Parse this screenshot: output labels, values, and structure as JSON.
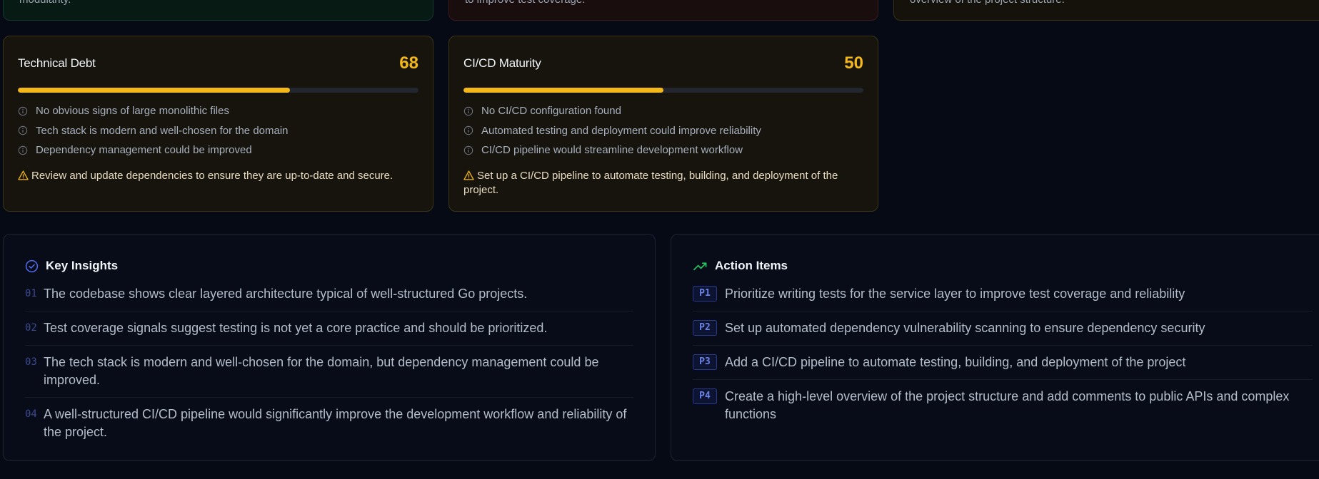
{
  "top_cards": [
    {
      "fragment": "modularity."
    },
    {
      "fragment": "to improve test coverage."
    },
    {
      "fragment": "overview of the project structure."
    }
  ],
  "technical_debt": {
    "title": "Technical Debt",
    "score": "68",
    "progress_percent": 68,
    "findings": [
      "No obvious signs of large monolithic files",
      "Tech stack is modern and well-chosen for the domain",
      "Dependency management could be improved"
    ],
    "recommendation": "Review and update dependencies to ensure they are up-to-date and secure."
  },
  "cicd_maturity": {
    "title": "CI/CD Maturity",
    "score": "50",
    "progress_percent": 50,
    "findings": [
      "No CI/CD configuration found",
      "Automated testing and deployment could improve reliability",
      "CI/CD pipeline would streamline development workflow"
    ],
    "recommendation": "Set up a CI/CD pipeline to automate testing, building, and deployment of the project."
  },
  "key_insights": {
    "title": "Key Insights",
    "items": [
      {
        "num": "01",
        "text": "The codebase shows clear layered architecture typical of well-structured Go projects."
      },
      {
        "num": "02",
        "text": "Test coverage signals suggest testing is not yet a core practice and should be prioritized."
      },
      {
        "num": "03",
        "text": "The tech stack is modern and well-chosen for the domain, but dependency management could be improved."
      },
      {
        "num": "04",
        "text": "A well-structured CI/CD pipeline would significantly improve the development workflow and reliability of the project."
      }
    ]
  },
  "action_items": {
    "title": "Action Items",
    "items": [
      {
        "priority": "P1",
        "text": "Prioritize writing tests for the service layer to improve test coverage and reliability"
      },
      {
        "priority": "P2",
        "text": "Set up automated dependency vulnerability scanning to ensure dependency security"
      },
      {
        "priority": "P3",
        "text": "Add a CI/CD pipeline to automate testing, building, and deployment of the project"
      },
      {
        "priority": "P4",
        "text": "Create a high-level overview of the project structure and add comments to public APIs and complex functions"
      }
    ]
  },
  "colors": {
    "accent_amber": "#f4b81a",
    "insight_blue": "#4f6bed",
    "action_green": "#22c55e"
  }
}
